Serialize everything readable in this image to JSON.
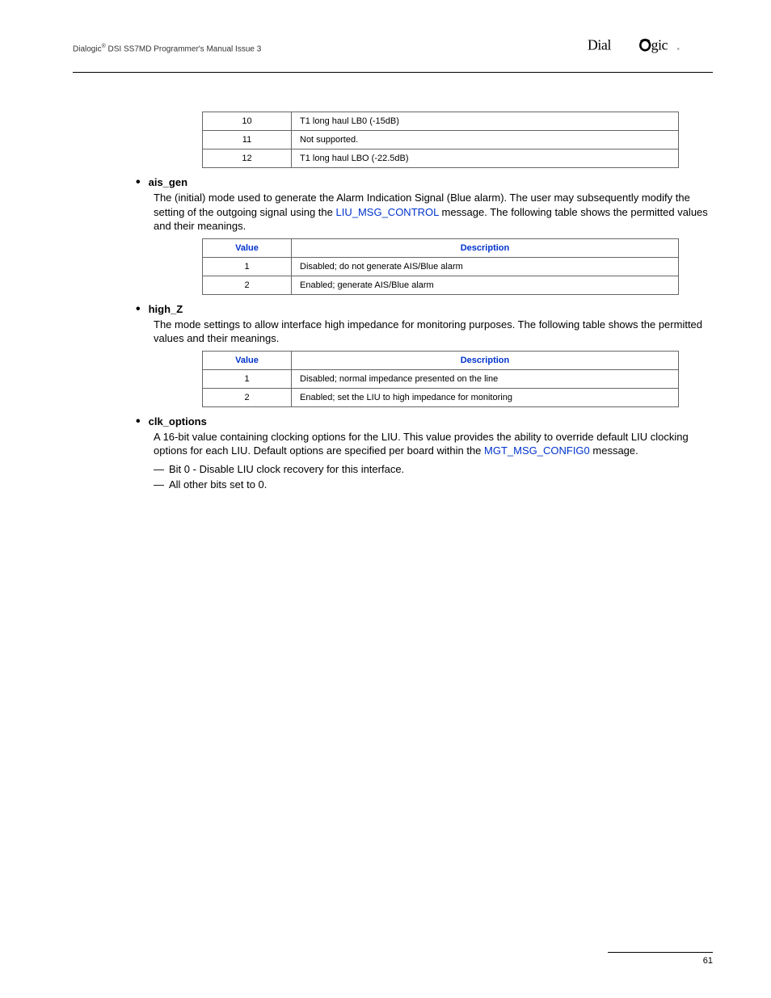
{
  "header": {
    "title_prefix": "Dialogic",
    "title_suffix": " DSI SS7MD Programmer's Manual  Issue 3",
    "logo": "Dialogic"
  },
  "table1": {
    "rows": [
      {
        "value": "10",
        "desc": "T1 long haul LB0 (-15dB)"
      },
      {
        "value": "11",
        "desc": "Not supported."
      },
      {
        "value": "12",
        "desc": "T1 long haul LBO (-22.5dB)"
      }
    ]
  },
  "ais_gen": {
    "title": "ais_gen",
    "desc_prefix": "The (initial) mode used to generate the Alarm Indication Signal (Blue alarm). The user may subsequently modify the setting of the outgoing signal using the ",
    "link": "LIU_MSG_CONTROL",
    "desc_suffix": " message. The following table shows the permitted values and their meanings.",
    "headers": {
      "value": "Value",
      "desc": "Description"
    },
    "rows": [
      {
        "value": "1",
        "desc": "Disabled; do not generate AIS/Blue alarm"
      },
      {
        "value": "2",
        "desc": "Enabled; generate AIS/Blue alarm"
      }
    ]
  },
  "high_z": {
    "title": "high_Z",
    "desc": "The mode settings to allow interface high impedance for monitoring purposes. The following table shows the permitted values and their meanings.",
    "headers": {
      "value": "Value",
      "desc": "Description"
    },
    "rows": [
      {
        "value": "1",
        "desc": "Disabled; normal impedance presented on the line"
      },
      {
        "value": "2",
        "desc": "Enabled; set the LIU to high impedance for monitoring"
      }
    ]
  },
  "clk_options": {
    "title": "clk_options",
    "desc_prefix": "A 16-bit value containing clocking options for the LIU. This value provides the ability to override default LIU clocking options for each LIU. Default options are specified per board within the ",
    "link": "MGT_MSG_CONFIG0",
    "desc_suffix": " message.",
    "items": [
      "Bit 0 - Disable LIU clock recovery for this interface.",
      "All other bits set to 0."
    ]
  },
  "footer": {
    "page": "61"
  }
}
